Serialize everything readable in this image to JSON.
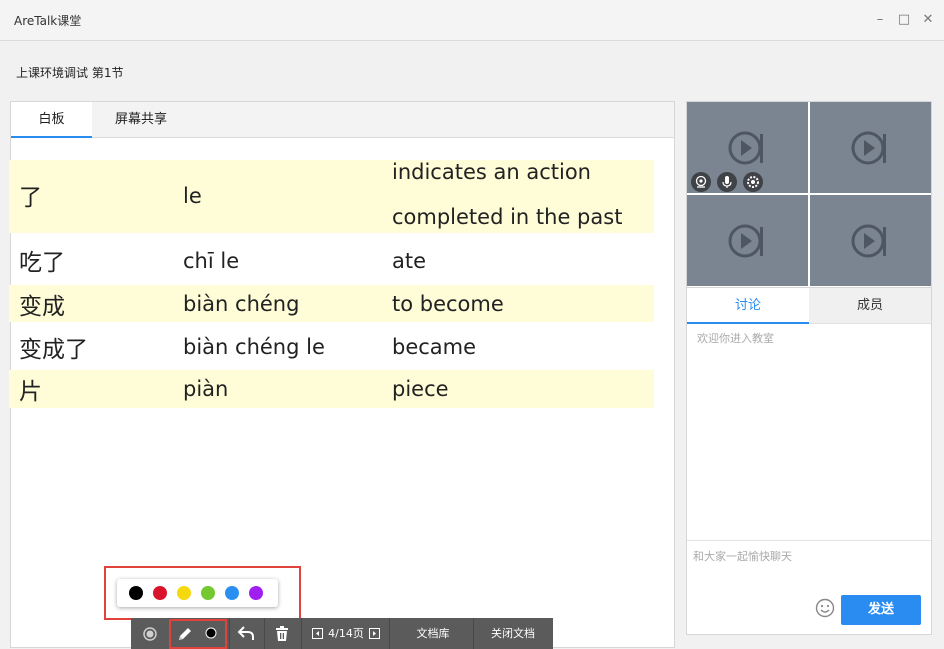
{
  "window": {
    "title": "AreTalk课堂",
    "controls": {
      "minimize": "–",
      "maximize": "□",
      "close": "✕"
    }
  },
  "course": {
    "title": "上课环境调试 第1节"
  },
  "board": {
    "tabs": [
      {
        "label": "白板",
        "active": true
      },
      {
        "label": "屏幕共享",
        "active": false
      }
    ],
    "slide": {
      "rows": [
        {
          "hanzi": "了",
          "pinyin": "le",
          "english": [
            "indicates an action",
            "completed in the past"
          ],
          "highlight": true
        },
        {
          "hanzi": "吃了",
          "pinyin": "chī  le",
          "english": [
            "ate"
          ],
          "highlight": false
        },
        {
          "hanzi": "变成",
          "pinyin": "biàn  chéng",
          "english": [
            "to become"
          ],
          "highlight": true
        },
        {
          "hanzi": "变成了",
          "pinyin": "biàn  chéng  le",
          "english": [
            "became"
          ],
          "highlight": false
        },
        {
          "hanzi": "片",
          "pinyin": "piàn",
          "english": [
            "piece"
          ],
          "highlight": true
        }
      ]
    }
  },
  "palette": {
    "colors": [
      {
        "name": "black",
        "hex": "#000000"
      },
      {
        "name": "red",
        "hex": "#d9132b"
      },
      {
        "name": "yellow",
        "hex": "#f5d90e"
      },
      {
        "name": "green",
        "hex": "#74c830"
      },
      {
        "name": "blue",
        "hex": "#2b8ff0"
      },
      {
        "name": "purple",
        "hex": "#a11ef0"
      }
    ]
  },
  "toolbar": {
    "record_icon": "record-icon",
    "pen_icon": "pen-icon",
    "pen_color": "#000000",
    "undo_icon": "undo-icon",
    "trash_icon": "trash-icon",
    "page_indicator": "4/14页",
    "doc_library": "文档库",
    "close_doc": "关闭文档"
  },
  "video": {
    "tiles": 4,
    "controls": [
      "camera-icon",
      "microphone-icon",
      "settings-icon"
    ],
    "tile_color": "#7b8591"
  },
  "side": {
    "tabs": [
      {
        "label": "讨论",
        "active": true
      },
      {
        "label": "成员",
        "active": false
      }
    ],
    "welcome": "欢迎你进入教室",
    "input_placeholder": "和大家一起愉快聊天",
    "send_label": "发送",
    "accent": "#2a8cf0"
  }
}
